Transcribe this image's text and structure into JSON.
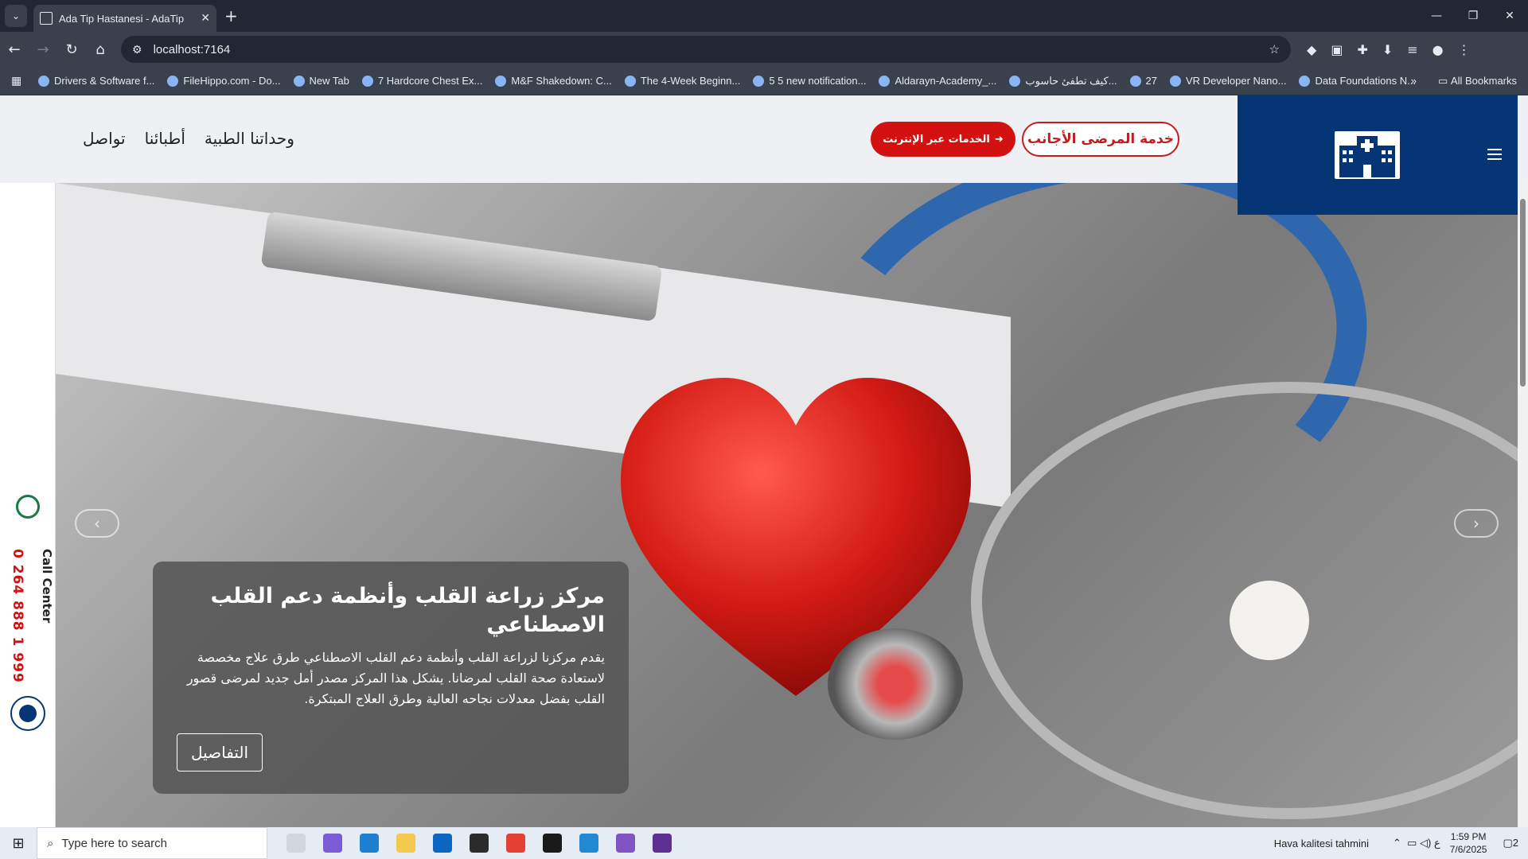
{
  "browser": {
    "tab_title": "Ada Tip Hastanesi - AdaTip",
    "url": "localhost:7164",
    "bookmarks": [
      "Drivers & Software f...",
      "FileHippo.com - Do...",
      "New Tab",
      "7 Hardcore Chest Ex...",
      "M&F Shakedown: C...",
      "The 4-Week Beginn...",
      "5 5 new notification...",
      "Aldarayn-Academy_...",
      "كيف تطفئ حاسوب...",
      "27",
      "VR Developer Nano...",
      "Data Foundations N..."
    ],
    "all_bookmarks": "All Bookmarks"
  },
  "header": {
    "nav": [
      "وحداتنا الطبية",
      "أطبائنا",
      "تواصل"
    ],
    "online_services": "الخدمات عبر الإنترنت",
    "foreign_patients": "خدمة المرضى الأجانب"
  },
  "sidebar": {
    "call_center_label": "Call Center",
    "phone": "0 264 888 1 999"
  },
  "hero": {
    "title": "مركز زراعة القلب وأنظمة دعم القلب الاصطناعي",
    "text": "يقدم مركزنا لزراعة القلب وأنظمة دعم القلب الاصطناعي طرق علاج مخصصة لاستعادة صحة القلب لمرضانا. يشكل هذا المركز مصدر أمل جديد لمرضى قصور القلب بفضل معدلات نجاحه العالية وطرق العلاج المبتكرة.",
    "details_button": "التفاصيل"
  },
  "taskbar": {
    "search_placeholder": "Type here to search",
    "weather": "Hava kalitesi tahmini",
    "time": "1:59 PM",
    "date": "7/6/2025",
    "lang": "ع",
    "notifications": "2"
  },
  "colors": {
    "brand_blue": "#053574",
    "brand_red": "#d31111"
  }
}
